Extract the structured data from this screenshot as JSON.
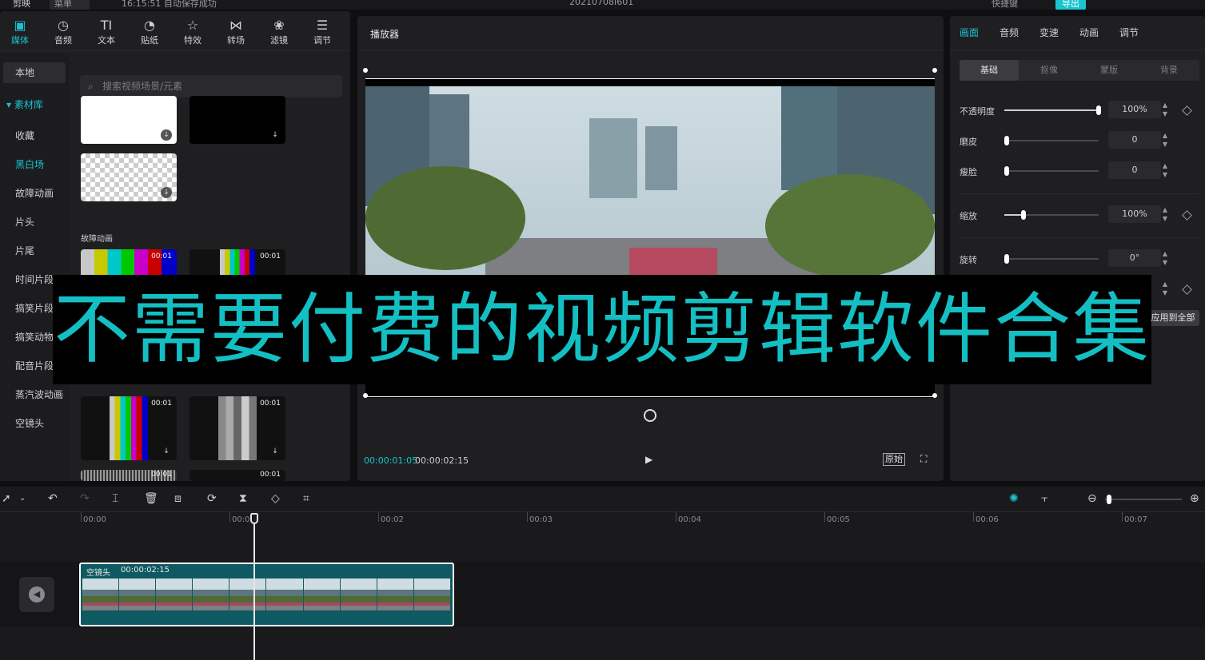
{
  "titlebar": {
    "app_name": "剪映",
    "menu_label": "菜单",
    "status_text": "16:15:51 自动保存成功",
    "project_name": "20210708I601",
    "shortcut_label": "快捷键",
    "export_label": "导出"
  },
  "media_tabs": [
    {
      "label": "媒体",
      "icon": "media-icon"
    },
    {
      "label": "音频",
      "icon": "audio-icon"
    },
    {
      "label": "文本",
      "icon": "text-icon"
    },
    {
      "label": "贴纸",
      "icon": "sticker-icon"
    },
    {
      "label": "特效",
      "icon": "effects-icon"
    },
    {
      "label": "转场",
      "icon": "transition-icon"
    },
    {
      "label": "滤镜",
      "icon": "filter-icon"
    },
    {
      "label": "调节",
      "icon": "adjust-icon"
    }
  ],
  "side_nav": {
    "local": "本地",
    "library": "▾ 素材库",
    "items": [
      "收藏",
      "黑白场",
      "故障动画",
      "片头",
      "片尾",
      "时间片段",
      "搞笑片段",
      "搞笑动物",
      "配音片段",
      "蒸汽波动画",
      "空镜头"
    ]
  },
  "search": {
    "placeholder": "搜索视频场景/元素"
  },
  "library": {
    "section_title": "故障动画",
    "thumb_durations": [
      "00:01",
      "00:01",
      "00:01",
      "00:01",
      "00:01",
      "00:01"
    ]
  },
  "player": {
    "title": "播放器",
    "current_time": "00:00:01:05",
    "total_time": "00:00:02:15",
    "original_label": "原始"
  },
  "right_panel": {
    "tabs": [
      "画面",
      "音频",
      "变速",
      "动画",
      "调节"
    ],
    "subtabs": [
      "基础",
      "抠像",
      "蒙版",
      "背景"
    ],
    "params": [
      {
        "label": "不透明度",
        "value": "100%",
        "level": 1.0
      },
      {
        "label": "磨皮",
        "value": "0",
        "level": 0.0
      },
      {
        "label": "瘦脸",
        "value": "0",
        "level": 0.0
      },
      {
        "label": "缩放",
        "value": "100%",
        "level": 0.2
      },
      {
        "label": "旋转",
        "value": "0°",
        "level": 0.0
      }
    ],
    "apply_all": "应用到全部"
  },
  "banner": {
    "text": "不需要付费的视频剪辑软件合集"
  },
  "timeline": {
    "ruler_labels": [
      "00:00",
      "00:01",
      "00:02",
      "00:03",
      "00:04",
      "00:05",
      "00:06",
      "00:07"
    ],
    "clip": {
      "name": "空镜头",
      "duration": "00:00:02:15"
    }
  },
  "colors": {
    "accent": "#19c3d0",
    "banner_text": "#14bfc3",
    "clip_fill": "#0f5a62"
  }
}
